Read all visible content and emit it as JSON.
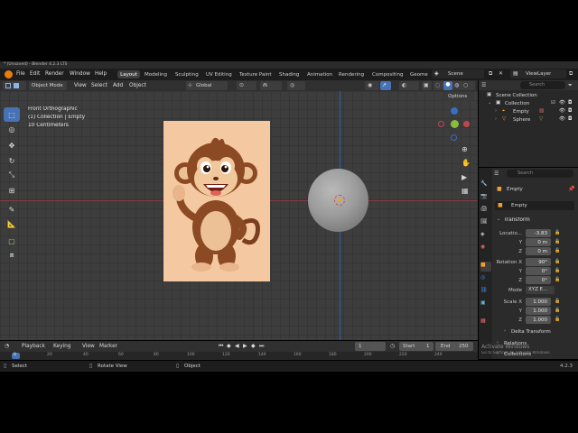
{
  "window": {
    "title": "* (Unsaved) - Blender 4.2.3 LTS"
  },
  "menubar": {
    "items": [
      "File",
      "Edit",
      "Render",
      "Window",
      "Help"
    ]
  },
  "workspaces": {
    "tabs": [
      "Layout",
      "Modeling",
      "Sculpting",
      "UV Editing",
      "Texture Paint",
      "Shading",
      "Animation",
      "Rendering",
      "Compositing",
      "Geome"
    ],
    "active": "Layout"
  },
  "scene": {
    "name": "Scene"
  },
  "view_layer": {
    "name": "ViewLayer"
  },
  "viewport_header": {
    "mode": "Object Mode",
    "menus": [
      "View",
      "Select",
      "Add",
      "Object"
    ],
    "transform_orientation": "Global",
    "options_label": "Options"
  },
  "viewport": {
    "view_name": "Front Orthographic",
    "collection_info": "(1) Collection | Empty",
    "scale_info": "10 Centimeters"
  },
  "outliner": {
    "search_placeholder": "Search",
    "items": [
      {
        "label": "Scene Collection"
      },
      {
        "label": "Collection"
      },
      {
        "label": "Empty"
      },
      {
        "label": "Sphere"
      }
    ]
  },
  "properties": {
    "search_placeholder": "Search",
    "object_name": "Empty",
    "data_name": "Empty",
    "transform_title": "Transform",
    "location_label": "Locatio...",
    "location": {
      "x": "-3.83",
      "y": "0 m",
      "z": "0 m"
    },
    "rotation_label": "Rotation X",
    "rotation": {
      "x": "90°",
      "y": "0°",
      "z": "0°"
    },
    "mode_label": "Mode",
    "rotation_mode": "XYZ E...",
    "scale_label": "Scale X",
    "scale": {
      "x": "1.000",
      "y": "1.000",
      "z": "1.000"
    },
    "axis_y": "Y",
    "axis_z": "Z",
    "delta_transform": "Delta Transform",
    "relations": "Relations",
    "collections": "Collections"
  },
  "timeline": {
    "menus": [
      "Playback",
      "Keying",
      "View",
      "Marker"
    ],
    "current_frame": "1",
    "start_label": "Start",
    "start": "1",
    "end_label": "End",
    "end": "250",
    "ruler_ticks": [
      "0",
      "20",
      "40",
      "60",
      "80",
      "100",
      "120",
      "140",
      "160",
      "180",
      "200",
      "220",
      "240"
    ]
  },
  "statusbar": {
    "select": "Select",
    "rotate_view": "Rotate View",
    "object": "Object",
    "version": "4.2.3",
    "watermark_line1": "Activate Windows",
    "watermark_line2": "Go to Settings to activate Windows."
  },
  "colors": {
    "accent": "#4772b3",
    "grid": "#3d3d3d",
    "x_axis": "#c1454f",
    "y_axis": "#5e8d26",
    "z_axis": "#3b6ec1",
    "selected_origin": "#f0a030",
    "image_bg": "#f4c9a1"
  }
}
